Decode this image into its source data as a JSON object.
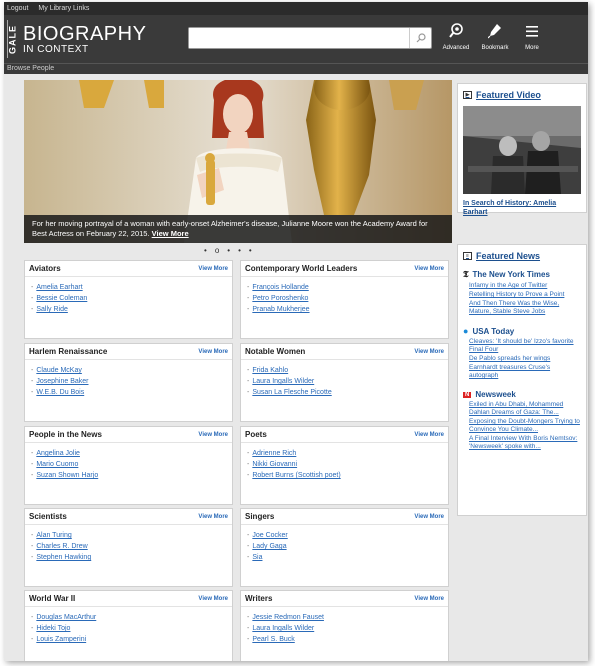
{
  "topbar": {
    "logout": "Logout",
    "library_links": "My Library Links"
  },
  "brand": {
    "gale": "GALE",
    "title": "BIOGRAPHY",
    "subtitle": "IN CONTEXT"
  },
  "search": {
    "placeholder": "",
    "icon": "search-icon"
  },
  "header_actions": [
    {
      "label": "Advanced",
      "icon": "advanced-search-icon"
    },
    {
      "label": "Bookmark",
      "icon": "bookmark-icon"
    },
    {
      "label": "More",
      "icon": "menu-icon"
    }
  ],
  "browse": "Browse People",
  "hero": {
    "caption": "For her moving portrayal of a woman with early-onset Alzheimer's disease, Julianne Moore won the Academy Award for Best Actress on February 22, 2015.",
    "view_more": "View More",
    "dots": [
      "•",
      "o",
      "•",
      "•",
      "•"
    ]
  },
  "cards": [
    {
      "title": "Aviators",
      "view_more": "View More",
      "items": [
        "Amelia Earhart",
        "Bessie Coleman",
        "Sally Ride"
      ]
    },
    {
      "title": "Contemporary World Leaders",
      "view_more": "View More",
      "items": [
        "François Hollande",
        "Petro Poroshenko",
        "Pranab Mukherjee"
      ]
    },
    {
      "title": "Harlem Renaissance",
      "view_more": "View More",
      "items": [
        "Claude McKay",
        "Josephine Baker",
        "W.E.B. Du Bois"
      ]
    },
    {
      "title": "Notable Women",
      "view_more": "View More",
      "items": [
        "Frida Kahlo",
        "Laura Ingalls Wilder",
        "Susan La Flesche Picotte"
      ]
    },
    {
      "title": "People in the News",
      "view_more": "View More",
      "items": [
        "Angelina Jolie",
        "Mario Cuomo",
        "Suzan Shown Harjo"
      ]
    },
    {
      "title": "Poets",
      "view_more": "View More",
      "items": [
        "Adrienne Rich",
        "Nikki Giovanni",
        "Robert Burns (Scottish poet)"
      ]
    },
    {
      "title": "Scientists",
      "view_more": "View More",
      "items": [
        "Alan Turing",
        "Charles R. Drew",
        "Stephen Hawking"
      ]
    },
    {
      "title": "Singers",
      "view_more": "View More",
      "items": [
        "Joe Cocker",
        "Lady Gaga",
        "Sia"
      ]
    },
    {
      "title": "World War II",
      "view_more": "View More",
      "items": [
        "Douglas MacArthur",
        "Hideki Tojo",
        "Louis Zamperini"
      ]
    },
    {
      "title": "Writers",
      "view_more": "View More",
      "items": [
        "Jessie Redmon Fauset",
        "Laura Ingalls Wilder",
        "Pearl S. Buck"
      ]
    }
  ],
  "featured_video": {
    "heading": "Featured Video",
    "link": "In Search of History: Amelia Earhart"
  },
  "featured_news": {
    "heading": "Featured News",
    "sources": [
      {
        "name": "The New York Times",
        "logo": "𝕿",
        "items": [
          "Infamy in the Age of Twitter",
          "Retelling History to Prove a Point",
          "And Then There Was the Wise, Mature, Stable Steve Jobs"
        ]
      },
      {
        "name": "USA Today",
        "logo": "●",
        "items": [
          "Cleaves: 'It should be' Izzo's favorite Final Four",
          "De Pablo spreads her wings",
          "Earnhardt treasures Cruse's autograph"
        ]
      },
      {
        "name": "Newsweek",
        "logo": "N",
        "items": [
          "Exiled in Abu Dhabi, Mohammed Dahlan Dreams of Gaza: The...",
          "Exposing the Doubt-Mongers Trying to Convince You Climate...",
          "A Final Interview With Boris Nemtsov: 'Newsweek' spoke with..."
        ]
      }
    ]
  },
  "colors": {
    "header": "#3a3a3a",
    "link": "#2a6ab8",
    "heading": "#1c4f8e",
    "usa_today": "#1a8ad8",
    "newsweek": "#d22"
  }
}
